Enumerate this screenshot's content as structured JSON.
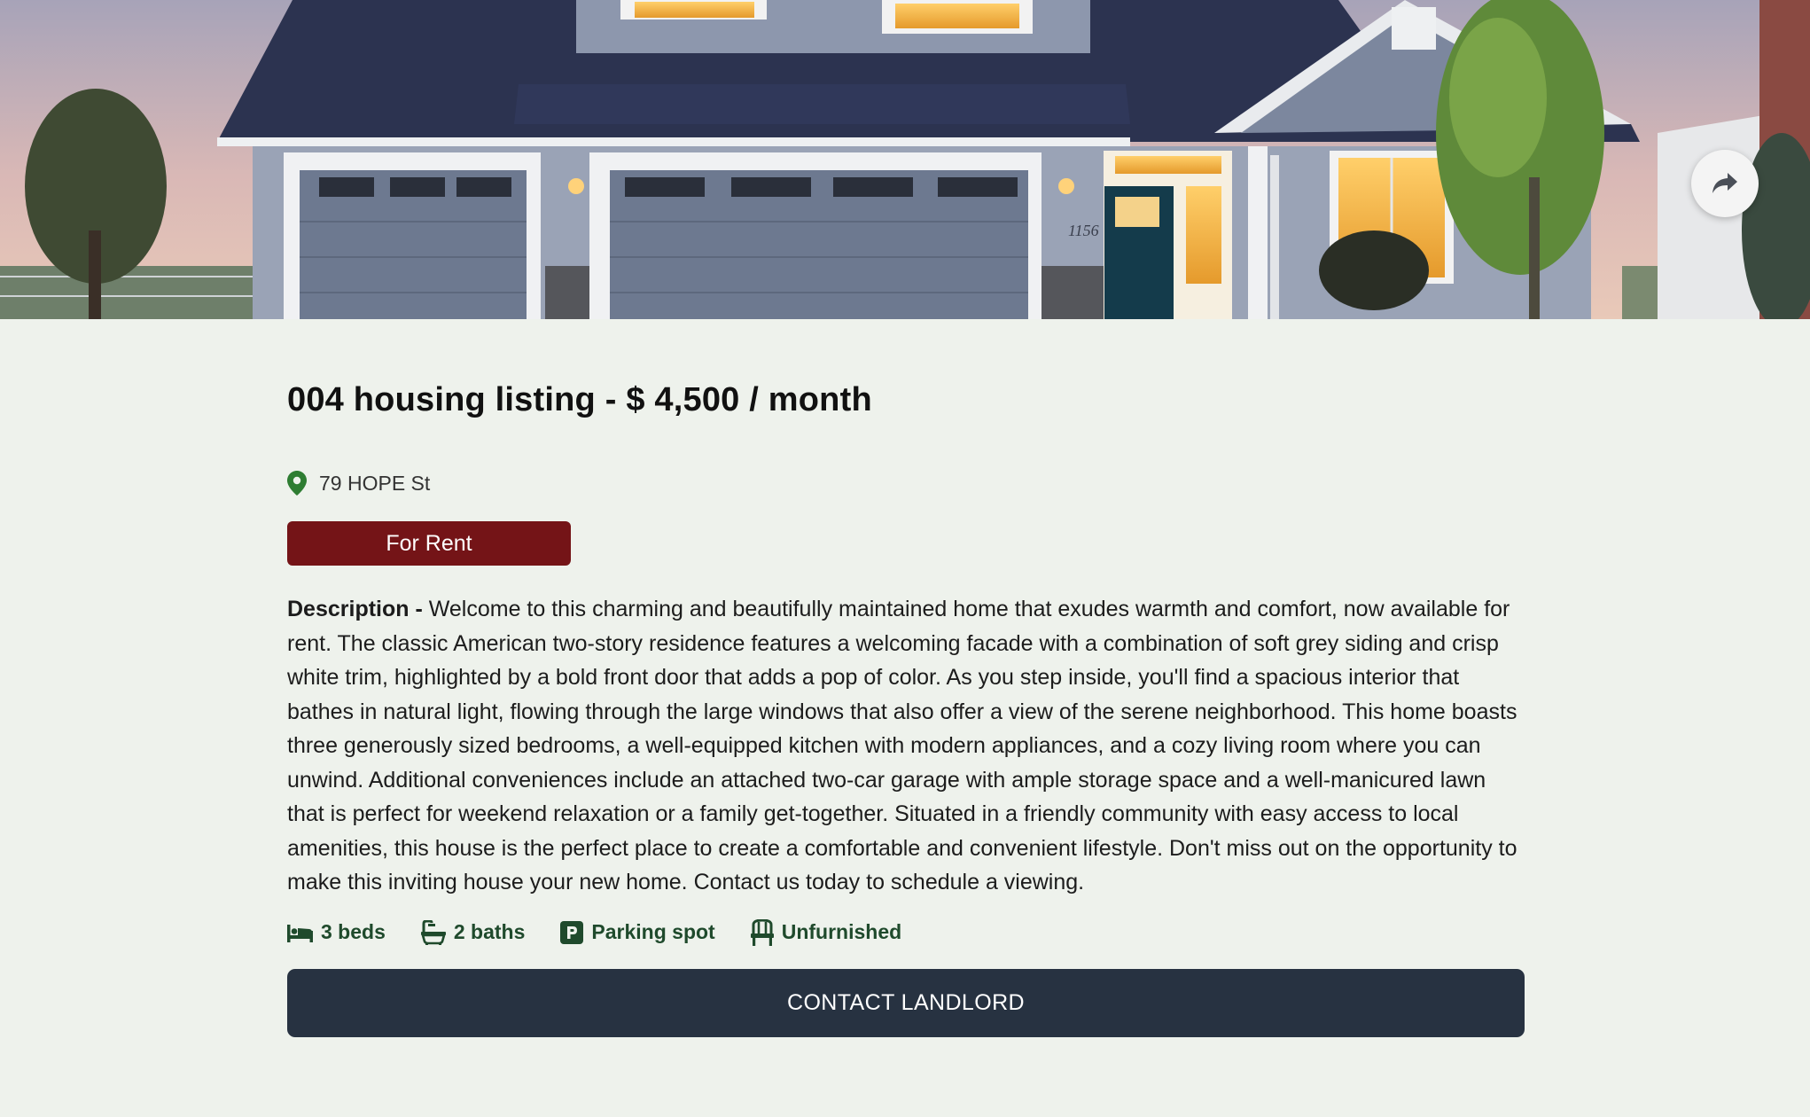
{
  "listing": {
    "title": "004 housing listing - $ 4,500 / month",
    "address": "79 HOPE St",
    "status_badge": "For Rent",
    "description_label": "Description - ",
    "description": "Welcome to this charming and beautifully maintained home that exudes warmth and comfort, now available for rent. The classic American two-story residence features a welcoming facade with a combination of soft grey siding and crisp white trim, highlighted by a bold front door that adds a pop of color. As you step inside, you'll find a spacious interior that bathes in natural light, flowing through the large windows that also offer a view of the serene neighborhood. This home boasts three generously sized bedrooms, a well-equipped kitchen with modern appliances, and a cozy living room where you can unwind. Additional conveniences include an attached two-car garage with ample storage space and a well-manicured lawn that is perfect for weekend relaxation or a family get-together. Situated in a friendly community with easy access to local amenities, this house is the perfect place to create a comfortable and convenient lifestyle. Don't miss out on the opportunity to make this inviting house your new home. Contact us today to schedule a viewing.",
    "house_number_sign": "1156"
  },
  "features": [
    {
      "icon": "bed-icon",
      "label": "3 beds"
    },
    {
      "icon": "bathtub-icon",
      "label": "2 baths"
    },
    {
      "icon": "parking-icon",
      "label": "Parking spot"
    },
    {
      "icon": "chair-icon",
      "label": "Unfurnished"
    }
  ],
  "actions": {
    "contact_label": "CONTACT LANDLORD",
    "share_icon": "share-icon"
  },
  "colors": {
    "background": "#eef2ec",
    "badge": "#741417",
    "contact_button": "#273241",
    "feature_text": "#1f4a2c",
    "pin": "#2e7d32"
  }
}
